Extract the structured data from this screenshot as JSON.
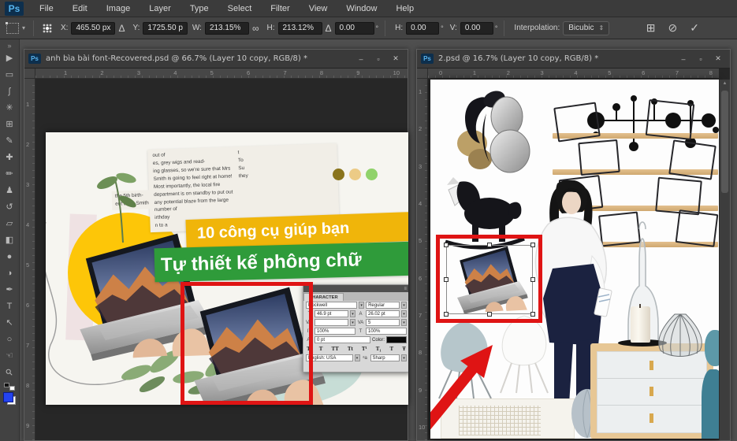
{
  "menubar": {
    "logo": "Ps",
    "items": [
      "File",
      "Edit",
      "Image",
      "Layer",
      "Type",
      "Select",
      "Filter",
      "View",
      "Window",
      "Help"
    ]
  },
  "options": {
    "x_label": "X:",
    "x_value": "465.50 px",
    "delta_icon": "Δ",
    "y_label": "Y:",
    "y_value": "1725.50 p",
    "w_label": "W:",
    "w_value": "213.15%",
    "link_icon": "∞",
    "h_label": "H:",
    "h_value": "213.12%",
    "rotate_icon": "Δ",
    "rotate_value": "0.00",
    "degree": "°",
    "hskew_label": "H:",
    "hskew_value": "0.00",
    "vskew_label": "V:",
    "vskew_value": "0.00",
    "interp_label": "Interpolation:",
    "interp_value": "Bicubic",
    "interp_caret": "⇕",
    "warp_icon": "⊞",
    "cancel_icon": "⊘",
    "commit_icon": "✓",
    "preset_caret": "▾"
  },
  "toolbar": {
    "glyphs": [
      "»",
      "▶",
      "▭",
      "ʃ",
      "✳",
      "⊞",
      "✎",
      "✚",
      "✏",
      "♟",
      "↺",
      "▱",
      "◧",
      "●",
      "◑",
      "✒",
      "T",
      "↖",
      "○",
      "☜",
      "⚲"
    ]
  },
  "window_controls": {
    "minimize": "–",
    "maximize": "▫",
    "close": "✕"
  },
  "left_doc": {
    "ps_badge": "Ps",
    "title": "anh bìa bài font-Recovered.psd @ 66.7% (Layer 10 copy, RGB/8) *",
    "ruler_h": [
      "1",
      "2",
      "3",
      "4",
      "5",
      "6",
      "7",
      "8",
      "9",
      "10"
    ],
    "ruler_v": [
      "1",
      "2",
      "3",
      "4",
      "5",
      "6",
      "7",
      "8",
      "9"
    ],
    "collage": {
      "news_lines": [
        "out of",
        "es, grey wigs and read-",
        "ing glasses, so we're sure that Mrs",
        "Smith is going to feel right at home!",
        "  Most importantly, the local fire",
        "department is on standby to put out",
        "any potential blaze from the large",
        "number of",
        "irthday",
        "n to a"
      ],
      "news_right_lines": [
        "t",
        "To",
        "",
        "Su",
        "they"
      ],
      "news_left_lines": [
        "the 5th birth-",
        "ent Jane Smith"
      ],
      "banner1": "10 công cụ giúp bạn",
      "banner2": "Tự thiết kế phông chữ"
    },
    "char_panel": {
      "tab": "CHARACTER",
      "menu_icon": "≡",
      "font": "Rockwell",
      "style": "Regular",
      "size_icon": "T",
      "size": "46.9 pt",
      "leading_icon": "A",
      "leading": "26.02 pt",
      "kern_icon": "V∕A",
      "kern": "",
      "track_icon": "VA",
      "track": "5",
      "vscale_icon": "IT",
      "vscale": "100%",
      "hscale_icon": "T",
      "hscale": "100%",
      "baseline_icon": "Aª",
      "baseline": "0 pt",
      "color_label": "Color:",
      "buttons": [
        "T",
        "T",
        "TT",
        "Tt",
        "T¹",
        "T₁",
        "T",
        "Ŧ"
      ],
      "language": "English: USA",
      "aa": "ᵃa",
      "aa_value": "Sharp",
      "arrow": "▾"
    }
  },
  "right_doc": {
    "ps_badge": "Ps",
    "title": "2.psd @ 16.7% (Layer 10 copy, RGB/8) *",
    "ruler_h": [
      "0",
      "1",
      "2",
      "3",
      "4",
      "5",
      "6",
      "7",
      "8"
    ],
    "ruler_v": [
      "1",
      "2",
      "3",
      "4",
      "5",
      "6",
      "7",
      "8",
      "9",
      "10"
    ],
    "scroll_up": "▲"
  },
  "colors": {
    "annotation_red": "#df1414",
    "banner_yellow": "#f0b50a",
    "banner_green": "#2f9b3a",
    "dot_olive": "#8a741c",
    "dot_tan": "#eccb86",
    "dot_green": "#90d26a",
    "foreground_blue": "#2443ef"
  }
}
